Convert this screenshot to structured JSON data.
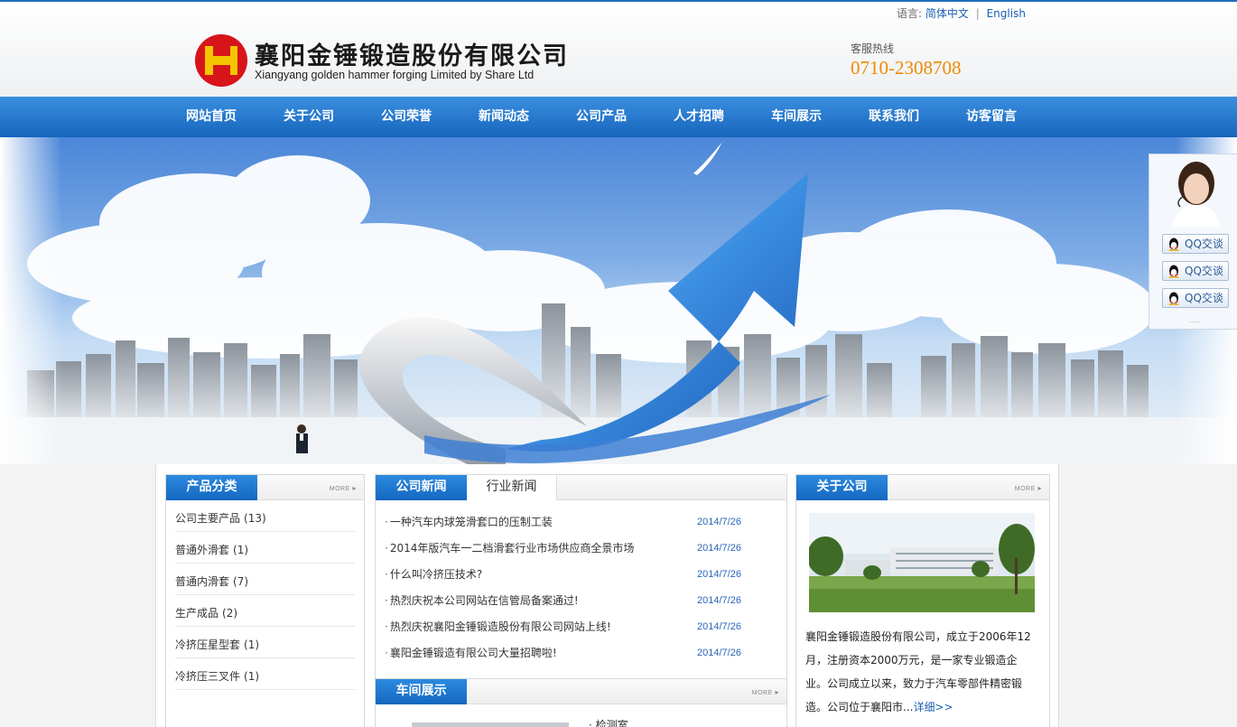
{
  "header": {
    "lang_label": "语言:",
    "lang_cn": "简体中文",
    "lang_sep": "|",
    "lang_en": "English",
    "company_cn": "襄阳金锤锻造股份有限公司",
    "company_en": "Xiangyang golden hammer forging Limited by Share Ltd",
    "hotline_label": "客服热线",
    "hotline_number": "0710-2308708"
  },
  "nav": {
    "items": [
      "网站首页",
      "关于公司",
      "公司荣誉",
      "新闻动态",
      "公司产品",
      "人才招聘",
      "车间展示",
      "联系我们",
      "访客留言"
    ]
  },
  "qq": {
    "buttons": [
      "QQ交谈",
      "QQ交谈",
      "QQ交谈"
    ],
    "dots": "....."
  },
  "products": {
    "title": "产品分类",
    "more": "MORE",
    "items": [
      {
        "name": "公司主要产品",
        "count": "(13)"
      },
      {
        "name": "普通外滑套",
        "count": "(1)"
      },
      {
        "name": "普通内滑套",
        "count": "(7)"
      },
      {
        "name": "生产成品",
        "count": "(2)"
      },
      {
        "name": "冷挤压星型套",
        "count": "(1)"
      },
      {
        "name": "冷挤压三叉件",
        "count": "(1)"
      }
    ]
  },
  "news": {
    "tab_active": "公司新闻",
    "tab_other": "行业新闻",
    "items": [
      {
        "title": "一种汽车内球笼滑套口的压制工装",
        "date": "2014/7/26"
      },
      {
        "title": "2014年版汽车一二档滑套行业市场供应商全景市场",
        "date": "2014/7/26"
      },
      {
        "title": "什么叫冷挤压技术?",
        "date": "2014/7/26"
      },
      {
        "title": "热烈庆祝本公司网站在信管局备案通过!",
        "date": "2014/7/26"
      },
      {
        "title": "热烈庆祝襄阳金锤锻造股份有限公司网站上线!",
        "date": "2014/7/26"
      },
      {
        "title": "襄阳金锤锻造有限公司大量招聘啦!",
        "date": "2014/7/26"
      }
    ]
  },
  "workshop": {
    "title": "车间展示",
    "more": "MORE",
    "item_title": "检测室"
  },
  "about": {
    "title": "关于公司",
    "more": "MORE",
    "text": "襄阳金锤锻造股份有限公司，成立于2006年12月，注册资本2000万元，是一家专业锻造企业。公司成立以来，致力于汽车零部件精密锻造。公司位于襄阳市...",
    "detail_link": "详细>>"
  },
  "colors": {
    "brand_blue": "#1765be",
    "hotline_orange": "#f08a00",
    "logo_red": "#d7141a",
    "logo_yellow": "#f5c400"
  }
}
